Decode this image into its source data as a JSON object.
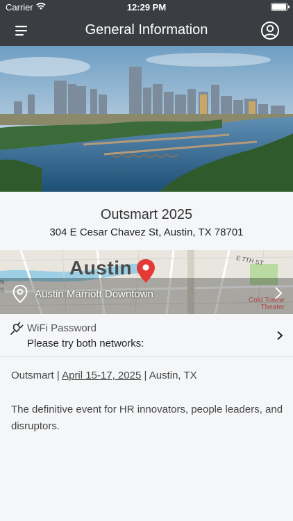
{
  "status_bar": {
    "carrier": "Carrier",
    "time": "12:29 PM"
  },
  "nav": {
    "title": "General Information",
    "menu_icon": "hamburger-menu-icon",
    "profile_icon": "user-profile-icon"
  },
  "event": {
    "name": "Outsmart 2025",
    "address": "304 E Cesar Chavez St, Austin, TX 78701"
  },
  "map": {
    "city": "Austin",
    "street": "E 7TH ST",
    "venue": "Austin Marriott Downtown",
    "poi": "Cold Towne\nTheater",
    "side": "N\nS"
  },
  "wifi": {
    "label": "WiFi Password",
    "value": "Please try both networks:"
  },
  "details": {
    "prefix": "Outsmart | ",
    "dates": "April 15-17, 2025",
    "suffix": " | Austin, TX",
    "description": "The definitive event for HR innovators, people leaders, and disruptors."
  },
  "colors": {
    "nav_background": "#3a3d42",
    "page_background": "#f5f6f8",
    "pin_red": "#e53935"
  }
}
